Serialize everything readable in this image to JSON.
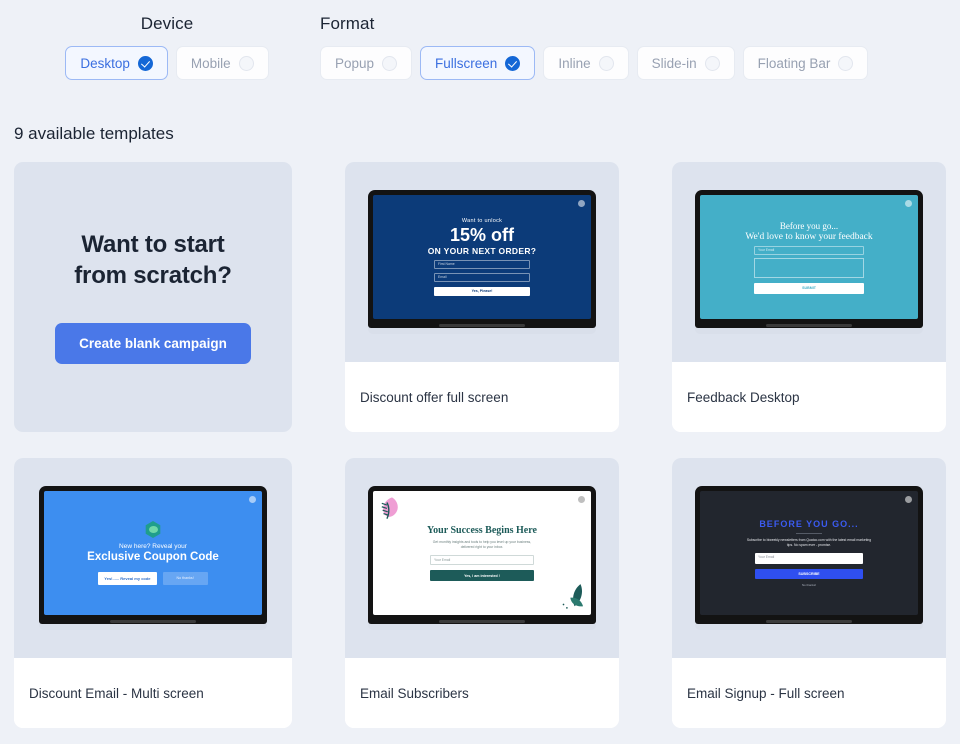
{
  "filters": {
    "device": {
      "title": "Device",
      "options": [
        {
          "label": "Desktop",
          "selected": true
        },
        {
          "label": "Mobile",
          "selected": false
        }
      ]
    },
    "format": {
      "title": "Format",
      "options": [
        {
          "label": "Popup",
          "selected": false
        },
        {
          "label": "Fullscreen",
          "selected": true
        },
        {
          "label": "Inline",
          "selected": false
        },
        {
          "label": "Slide-in",
          "selected": false
        },
        {
          "label": "Floating Bar",
          "selected": false
        }
      ]
    }
  },
  "results": {
    "count_label": "9 available templates"
  },
  "blank_card": {
    "title_line1": "Want to start",
    "title_line2": "from scratch?",
    "button_label": "Create blank campaign"
  },
  "templates": [
    {
      "name": "Discount offer full screen",
      "preview": {
        "eyebrow": "Want to unlock",
        "headline": "15% off",
        "subhead": "ON YOUR NEXT ORDER?",
        "field1": "First Name",
        "field2": "Email",
        "button": "Yes, Please!"
      }
    },
    {
      "name": "Feedback Desktop",
      "preview": {
        "line1": "Before you go...",
        "line2": "We'd love to know your feedback",
        "field1": "Your Email",
        "button": "SUBMIT"
      }
    },
    {
      "name": "Discount Email - Multi screen",
      "preview": {
        "eyebrow": "New here? Reveal your",
        "headline": "Exclusive Coupon Code",
        "button_primary": "Yes!...... Reveal my code",
        "button_secondary": "No thanks!"
      }
    },
    {
      "name": "Email Subscribers",
      "preview": {
        "headline": "Your Success Begins Here",
        "body": "Get monthly insights and tools to help you level up your business, delivered right to your inbox.",
        "field1": "Your Email",
        "button": "Yes, I am interested !"
      }
    },
    {
      "name": "Email Signup - Full screen",
      "preview": {
        "headline": "BEFORE YOU GO...",
        "body": "Subscribe to biweekly newsletters from Quatco.com with the latest email marketing tips. No spam ever - promise.",
        "field1": "Your Email",
        "button": "SUBSCRIBE",
        "decline": "No thanks!"
      }
    }
  ],
  "colors": {
    "page_bg": "#eef1f7",
    "card_bg": "#dde3ee",
    "accent": "#4a78e8",
    "selected_chip_text": "#3b6fe0",
    "check_blue": "#1467d6"
  }
}
